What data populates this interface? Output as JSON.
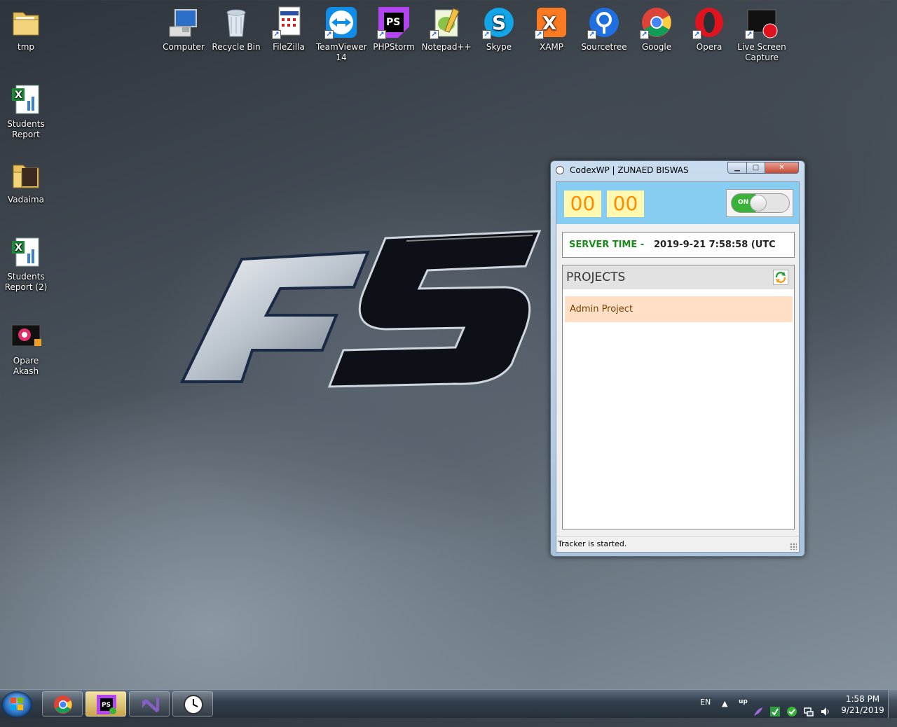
{
  "desktop_left": [
    {
      "label": "tmp",
      "icon": "folder-icon"
    },
    {
      "label": "Students Report",
      "icon": "excel-file-icon"
    },
    {
      "label": "Vadaima",
      "icon": "folder-icon"
    },
    {
      "label": "Students Report (2)",
      "icon": "excel-file-icon"
    },
    {
      "label": "Opare Akash",
      "icon": "video-file-icon"
    }
  ],
  "desktop_top": [
    {
      "label": "Computer",
      "icon": "computer-icon"
    },
    {
      "label": "Recycle Bin",
      "icon": "recycle-bin-icon"
    },
    {
      "label": "FileZilla",
      "icon": "filezilla-icon"
    },
    {
      "label": "TeamViewer 14",
      "icon": "teamviewer-icon"
    },
    {
      "label": "PHPStorm",
      "icon": "phpstorm-icon"
    },
    {
      "label": "Notepad++",
      "icon": "notepadpp-icon"
    },
    {
      "label": "Skype",
      "icon": "skype-icon"
    },
    {
      "label": "XAMP",
      "icon": "xampp-icon"
    },
    {
      "label": "Sourcetree",
      "icon": "sourcetree-icon"
    },
    {
      "label": "Google",
      "icon": "chrome-icon"
    },
    {
      "label": "Opera",
      "icon": "opera-icon"
    },
    {
      "label": "Live Screen Capture",
      "icon": "screen-capture-icon"
    }
  ],
  "window": {
    "title": "CodexWP | ZUNAED BISWAS",
    "min_glyph": "▁",
    "max_glyph": "□",
    "close_glyph": "✕",
    "timer_hours": "00",
    "timer_minutes": "00",
    "toggle_label": "ON",
    "server_label": "SERVER TIME -",
    "server_value": "2019-9-21 7:58:58 (UTC",
    "projects_title": "PROJECTS",
    "projects": [
      "Admin Project"
    ],
    "status": "Tracker is started."
  },
  "taskbar": {
    "apps": [
      "chrome-icon",
      "phpstorm-icon",
      "visual-studio-icon",
      "clock-app-icon"
    ],
    "language": "EN",
    "time": "1:58 PM",
    "date": "9/21/2019"
  },
  "colors": {
    "timer_bg": "#87cdf2",
    "digit_bg": "#fff8b0",
    "digit_fg": "#ff8c00",
    "server_label": "#1a8c1a",
    "project_bg": "#ffe0c6",
    "toggle_on": "#3ab23a"
  }
}
